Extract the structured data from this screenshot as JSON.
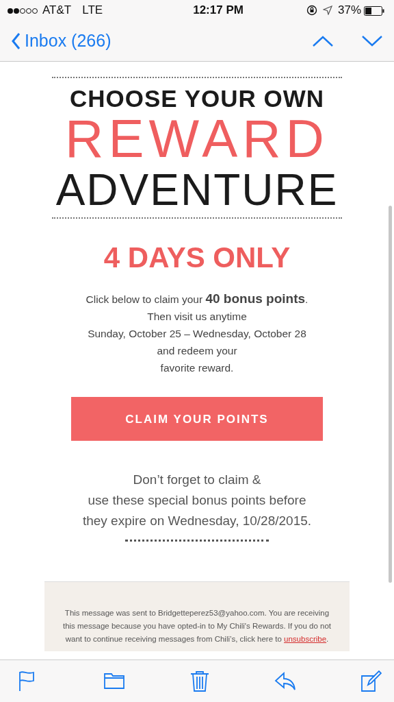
{
  "status_bar": {
    "carrier": "AT&T",
    "network": "LTE",
    "time": "12:17 PM",
    "battery": "37%"
  },
  "nav": {
    "back": "Inbox (266)"
  },
  "email": {
    "headline": [
      "CHOOSE YOUR OWN",
      "REWARD",
      "ADVENTURE"
    ],
    "title": "4 DAYS ONLY",
    "intro": [
      "Click below to claim your **40 bonus points**.",
      "Then visit us anytime",
      "Sunday, October 25 – Wednesday, October 28",
      "and redeem your",
      "favorite reward."
    ],
    "button": "CLAIM YOUR POINTS",
    "reminder": [
      "Don’t forget to claim &",
      "use these special bonus points before",
      "they expire on Wednesday, 10/28/2015."
    ],
    "footer": {
      "text": "This message was sent to Bridgetteperez53@yahoo.com. You are receiving this message because you have opted-in to My Chili's Rewards. If you do not want to continue receiving messages from Chili’s, click here to",
      "link": "unsubscribe",
      "end": "."
    }
  }
}
